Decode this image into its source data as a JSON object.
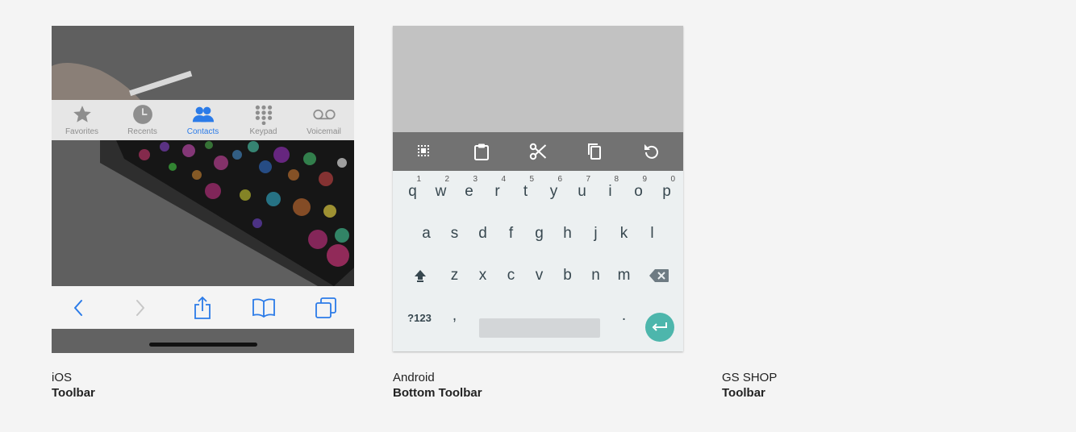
{
  "ios": {
    "tabbar": [
      {
        "label": "Favorites",
        "icon": "star-icon",
        "active": false
      },
      {
        "label": "Recents",
        "icon": "clock-icon",
        "active": false
      },
      {
        "label": "Contacts",
        "icon": "contacts-icon",
        "active": true
      },
      {
        "label": "Keypad",
        "icon": "keypad-icon",
        "active": false
      },
      {
        "label": "Voicemail",
        "icon": "voicemail-icon",
        "active": false
      }
    ],
    "toolbar": [
      "back-icon",
      "forward-icon",
      "share-icon",
      "bookmarks-icon",
      "tabs-icon"
    ],
    "accent_color": "#2b7be8",
    "caption": {
      "platform": "iOS",
      "type": "Toolbar"
    }
  },
  "android": {
    "toolbar": [
      "select-all-icon",
      "paste-icon",
      "cut-icon",
      "copy-icon",
      "undo-icon"
    ],
    "keyboard": {
      "row1": [
        {
          "key": "q",
          "num": "1"
        },
        {
          "key": "w",
          "num": "2"
        },
        {
          "key": "e",
          "num": "3"
        },
        {
          "key": "r",
          "num": "4"
        },
        {
          "key": "t",
          "num": "5"
        },
        {
          "key": "y",
          "num": "6"
        },
        {
          "key": "u",
          "num": "7"
        },
        {
          "key": "i",
          "num": "8"
        },
        {
          "key": "o",
          "num": "9"
        },
        {
          "key": "p",
          "num": "0"
        }
      ],
      "row2": [
        "a",
        "s",
        "d",
        "f",
        "g",
        "h",
        "j",
        "k",
        "l"
      ],
      "row3": [
        "z",
        "x",
        "c",
        "v",
        "b",
        "n",
        "m"
      ],
      "symbols_label": "?123",
      "comma": ",",
      "period": "."
    },
    "enter_color": "#4db6ac",
    "caption": {
      "platform": "Android",
      "type": "Bottom Toolbar"
    }
  },
  "gsshop": {
    "caption": {
      "platform": "GS SHOP",
      "type": "Toolbar"
    }
  }
}
